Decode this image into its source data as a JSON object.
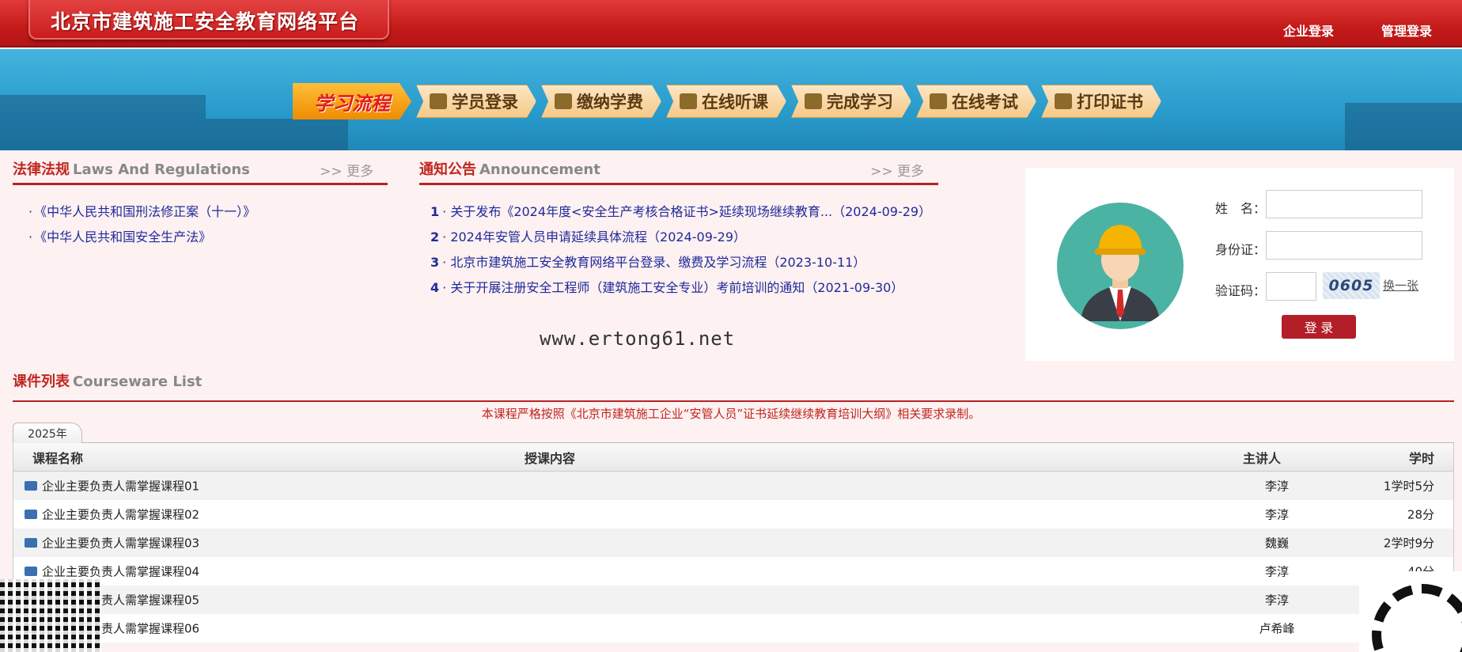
{
  "header": {
    "title": "北京市建筑施工安全教育网络平台",
    "company_login": "企业登录",
    "admin_login": "管理登录"
  },
  "flow": {
    "title": "学习流程",
    "steps": [
      "学员登录",
      "缴纳学费",
      "在线听课",
      "完成学习",
      "在线考试",
      "打印证书"
    ]
  },
  "laws": {
    "title_cn": "法律法规",
    "title_en": "Laws And Regulations",
    "more": ">> 更多",
    "items": [
      "《中华人民共和国刑法修正案（十一）》",
      "《中华人民共和国安全生产法》"
    ]
  },
  "notices": {
    "title_cn": "通知公告",
    "title_en": "Announcement",
    "more": ">> 更多",
    "items": [
      {
        "num": "1",
        "text": "· 关于发布《2024年度<安全生产考核合格证书>延续现场继续教育...（2024-09-29）"
      },
      {
        "num": "2",
        "text": "· 2024年安管人员申请延续具体流程（2024-09-29）"
      },
      {
        "num": "3",
        "text": "· 北京市建筑施工安全教育网络平台登录、缴费及学习流程（2023-10-11）"
      },
      {
        "num": "4",
        "text": "· 关于开展注册安全工程师（建筑施工安全专业）考前培训的通知（2021-09-30）"
      }
    ]
  },
  "watermark": "www.ertong61.net",
  "login": {
    "name_label": "姓　名：",
    "id_label": "身份证：",
    "captcha_label": "验证码：",
    "captcha_code": "0605",
    "refresh": "换一张",
    "submit": "登 录"
  },
  "courses": {
    "title_cn": "课件列表",
    "title_en": "Courseware List",
    "notice": "本课程严格按照《北京市建筑施工企业“安管人员”证书延续继续教育培训大纲》相关要求录制。",
    "tab": "2025年",
    "columns": {
      "name": "课程名称",
      "content": "授课内容",
      "teacher": "主讲人",
      "hours": "学时"
    },
    "rows": [
      {
        "name": "企业主要负责人需掌握课程01",
        "teacher": "李淳",
        "hours": "1学时5分"
      },
      {
        "name": "企业主要负责人需掌握课程02",
        "teacher": "李淳",
        "hours": "28分"
      },
      {
        "name": "企业主要负责人需掌握课程03",
        "teacher": "魏巍",
        "hours": "2学时9分"
      },
      {
        "name": "企业主要负责人需掌握课程04",
        "teacher": "李淳",
        "hours": "40分"
      },
      {
        "name": "企业主要负责人需掌握课程05",
        "teacher": "李淳",
        "hours": ""
      },
      {
        "name": "企业主要负责人需掌握课程06",
        "teacher": "卢希峰",
        "hours": ""
      }
    ]
  },
  "colors": {
    "brand_red": "#c41a1a",
    "accent": "#b32525",
    "link": "#20299a"
  }
}
